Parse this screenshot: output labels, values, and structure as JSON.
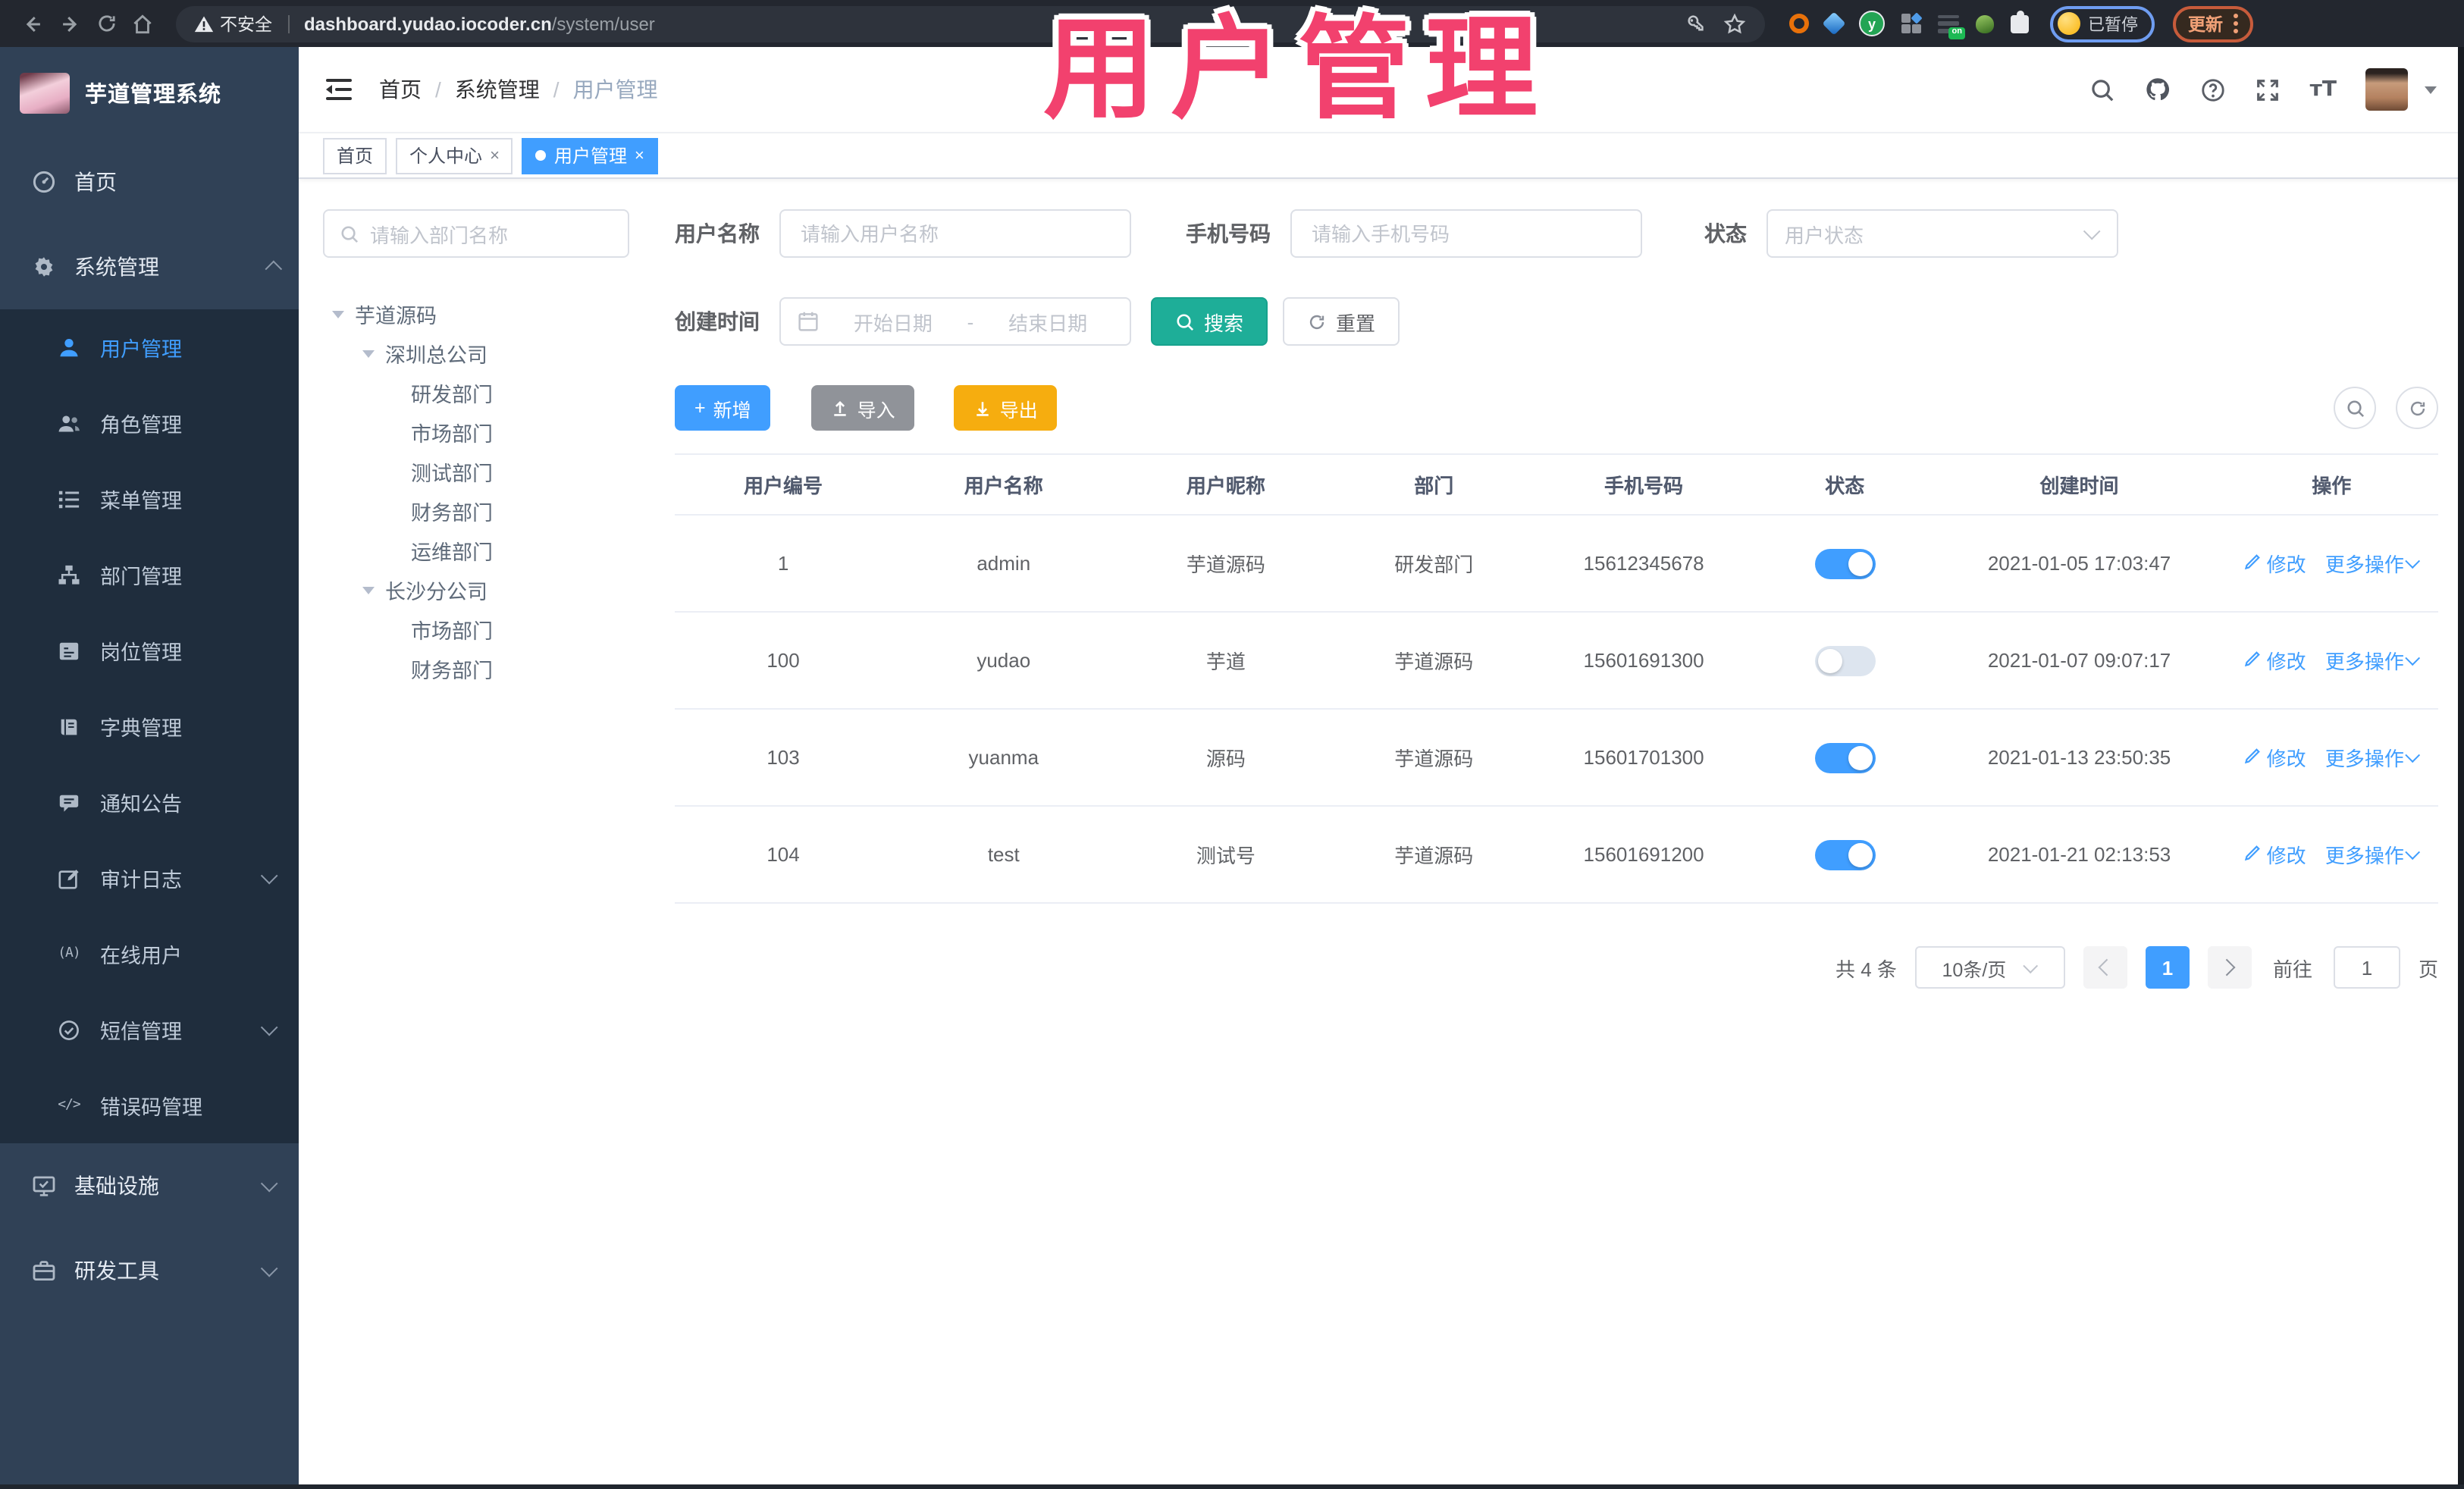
{
  "browser": {
    "warning": "不安全",
    "host": "dashboard.yudao.iocoder.cn",
    "path": "/system/user",
    "paused_badge": "已暂停",
    "update_label": "更新"
  },
  "annotation": {
    "text": "用户管理",
    "color": "#f2416e"
  },
  "sidebar": {
    "logo_title": "芋道管理系统",
    "home": "首页",
    "system": "系统管理",
    "system_children": [
      {
        "label": "用户管理",
        "active": true
      },
      {
        "label": "角色管理"
      },
      {
        "label": "菜单管理"
      },
      {
        "label": "部门管理"
      },
      {
        "label": "岗位管理"
      },
      {
        "label": "字典管理"
      },
      {
        "label": "通知公告"
      },
      {
        "label": "审计日志",
        "collapsible": true
      },
      {
        "label": "在线用户"
      },
      {
        "label": "短信管理",
        "collapsible": true
      },
      {
        "label": "错误码管理"
      }
    ],
    "infra": "基础设施",
    "devtools": "研发工具"
  },
  "header": {
    "breadcrumb": [
      "首页",
      "系统管理",
      "用户管理"
    ]
  },
  "tabs": [
    {
      "label": "首页"
    },
    {
      "label": "个人中心",
      "closable": true
    },
    {
      "label": "用户管理",
      "closable": true,
      "active": true
    }
  ],
  "dept_panel": {
    "search_placeholder": "请输入部门名称",
    "nodes": [
      {
        "label": "芋道源码",
        "level": 0,
        "expandable": true
      },
      {
        "label": "深圳总公司",
        "level": 1,
        "expandable": true
      },
      {
        "label": "研发部门",
        "level": 2
      },
      {
        "label": "市场部门",
        "level": 2
      },
      {
        "label": "测试部门",
        "level": 2
      },
      {
        "label": "财务部门",
        "level": 2
      },
      {
        "label": "运维部门",
        "level": 2
      },
      {
        "label": "长沙分公司",
        "level": 1,
        "expandable": true
      },
      {
        "label": "市场部门",
        "level": 2
      },
      {
        "label": "财务部门",
        "level": 2
      }
    ]
  },
  "filters": {
    "user_name": {
      "label": "用户名称",
      "placeholder": "请输入用户名称"
    },
    "mobile": {
      "label": "手机号码",
      "placeholder": "请输入手机号码"
    },
    "status": {
      "label": "状态",
      "placeholder": "用户状态"
    },
    "create_time": {
      "label": "创建时间",
      "start_placeholder": "开始日期",
      "separator": "-",
      "end_placeholder": "结束日期"
    },
    "search_label": "搜索",
    "reset_label": "重置"
  },
  "toolbar": {
    "add": "新增",
    "import": "导入",
    "export": "导出"
  },
  "table": {
    "columns": [
      "用户编号",
      "用户名称",
      "用户昵称",
      "部门",
      "手机号码",
      "状态",
      "创建时间",
      "操作"
    ],
    "rows": [
      {
        "id": "1",
        "username": "admin",
        "nickname": "芋道源码",
        "dept": "研发部门",
        "mobile": "15612345678",
        "status": true,
        "create_time": "2021-01-05 17:03:47"
      },
      {
        "id": "100",
        "username": "yudao",
        "nickname": "芋道",
        "dept": "芋道源码",
        "mobile": "15601691300",
        "status": false,
        "create_time": "2021-01-07 09:07:17"
      },
      {
        "id": "103",
        "username": "yuanma",
        "nickname": "源码",
        "dept": "芋道源码",
        "mobile": "15601701300",
        "status": true,
        "create_time": "2021-01-13 23:50:35"
      },
      {
        "id": "104",
        "username": "test",
        "nickname": "测试号",
        "dept": "芋道源码",
        "mobile": "15601691200",
        "status": true,
        "create_time": "2021-01-21 02:13:53"
      }
    ]
  },
  "row_actions": {
    "edit": "修改",
    "more": "更多操作"
  },
  "pagination": {
    "total": "共 4 条",
    "page_size": "10条/页",
    "current_page": "1",
    "goto_label": "前往",
    "goto_value": "1",
    "page_unit": "页"
  },
  "colors": {
    "accent": "#409eff",
    "search_button": "#1eae98",
    "import_button": "#909399",
    "export_button": "#f6ad0f",
    "annotation": "#f2416e",
    "sidebar_bg": "#304156",
    "submenu_bg": "#1f2d3d",
    "toggle_on": "#409eff",
    "active_tab_bg": "#409eff"
  }
}
